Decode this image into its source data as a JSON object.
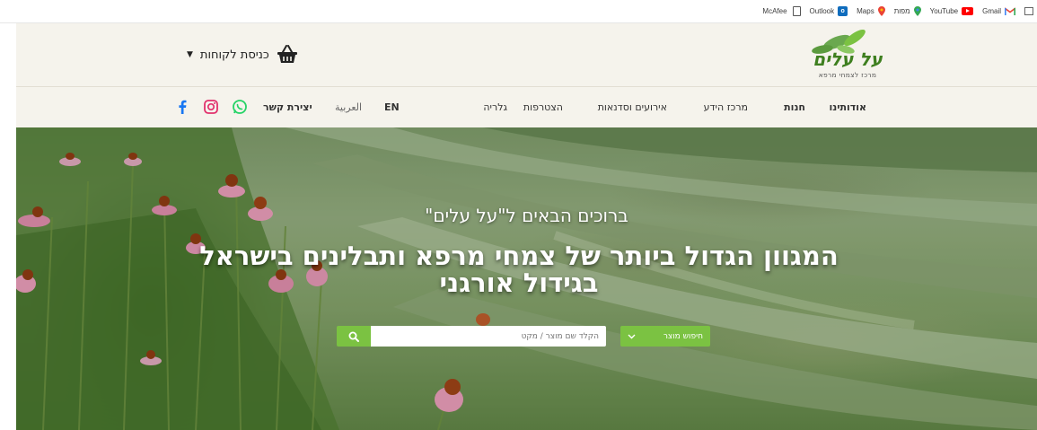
{
  "bookmarks": [
    {
      "label": "McAfee",
      "icon": "mcafee"
    },
    {
      "label": "",
      "icon": "document-icon"
    },
    {
      "label": "Outlook",
      "icon": "outlook-icon"
    },
    {
      "label": "Maps",
      "icon": "maps-pin-icon"
    },
    {
      "label": "מפות",
      "icon": "maps-pin-icon"
    },
    {
      "label": "YouTube",
      "icon": "youtube-icon"
    },
    {
      "label": "Gmail",
      "icon": "gmail-icon"
    }
  ],
  "header": {
    "logo_text": "על עלים",
    "logo_subtitle": "מרכז לצמחי מרפא",
    "login_label": "כניסת לקוחות"
  },
  "nav": {
    "items": [
      "אודותינו",
      "חנות",
      "מרכז הידע",
      "אירועים וסדנאות",
      "הצטרפות",
      "גלריה"
    ],
    "lang_en": "EN",
    "lang_ar": "العربية",
    "contact": "יצירת קשר"
  },
  "hero": {
    "welcome": "ברוכים הבאים ל\"על עלים\"",
    "headline": "המגוון הגדול ביותר של צמחי מרפא ותבלינים בישראל בגידול אורגני",
    "search_placeholder": "הקלד שם מוצר / מקט",
    "search_type": "חיפוש מוצר"
  },
  "colors": {
    "accent_green": "#7bc242",
    "header_bg": "#f5f3ec",
    "facebook": "#1877f2",
    "instagram": "#e1306c",
    "whatsapp": "#25d366"
  }
}
